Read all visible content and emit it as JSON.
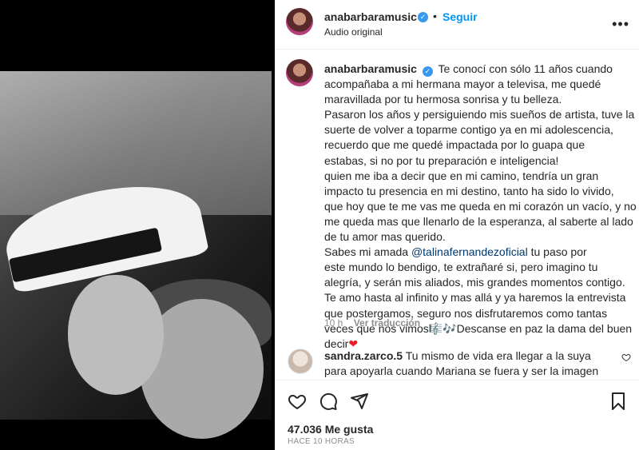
{
  "post": {
    "username": "anabarbaramusic",
    "follow_label": "Seguir",
    "audio_label": "Audio original",
    "more_label": "•••"
  },
  "caption": {
    "username": "anabarbaramusic",
    "lines": [
      "Te conocí con sólo 11 años cuando",
      "acompañaba a mi hermana mayor a televisa, me quedé",
      "maravillada por tu hermosa sonrisa y tu belleza.",
      "Pasaron los años y persiguiendo mis sueños de artista, tuve la",
      "suerte de volver a toparme contigo ya en mi adolescencia,",
      "recuerdo que me quedé impactada por lo guapa que",
      "estabas, si no por tu preparación e inteligencia!",
      "quien me iba a decir que en mi camino, tendría un gran",
      "impacto tu presencia en mi destino, tanto ha sido lo vivido,",
      "que hoy que te me vas me queda en mi corazón un vacío, y no",
      "me queda mas que llenarlo de la esperanza, al saberte al lado",
      "de tu amor mas querido."
    ],
    "mention_prefix": "Sabes mi amada ",
    "mention": "@talinafernandezoficial",
    "mention_suffix": " tu paso por",
    "lines2": [
      "este mundo lo bendigo, te extrañaré si, pero imagino tu",
      "alegría, y serán mis aliados, mis grandes momentos contigo.",
      "Te amo hasta al infinito y mas allá y ya haremos la entrevista",
      "que postergamos, seguro nos disfrutaremos como tantas",
      "veces que nos vimos🎼🎶Descanse en paz la dama del buen"
    ],
    "last_line": "decir",
    "heart": "❤",
    "age": "10 h",
    "translate_label": "Ver traducción"
  },
  "comment": {
    "username": "sandra.zarco.5",
    "text": "Tu mismo de vida era llegar a la suya para apoyarla cuando Mariana se fuera y ser la imagen materna"
  },
  "footer": {
    "likes": "47.036 Me gusta",
    "time": "HACE 10 HORAS"
  },
  "colors": {
    "accent": "#0095f6",
    "verified": "#3897f0",
    "mention": "#00376b",
    "muted": "#8e8e8e"
  },
  "icons": [
    "verified-badge-icon",
    "more-options-icon",
    "like-heart-icon",
    "comment-icon",
    "share-icon",
    "save-bookmark-icon",
    "comment-like-icon"
  ]
}
